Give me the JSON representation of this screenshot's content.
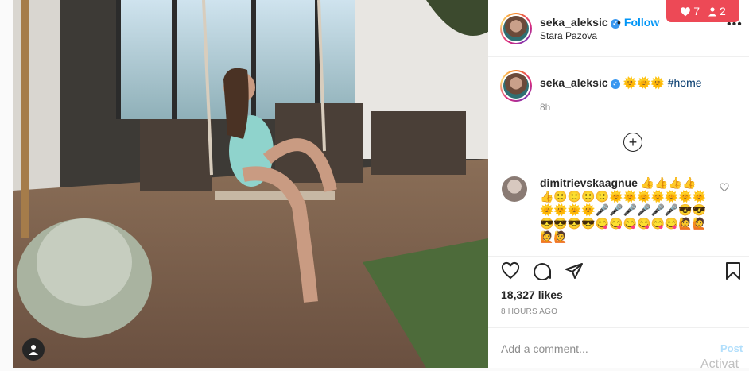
{
  "header": {
    "username": "seka_aleksic",
    "verified_mark": "✓",
    "separator": "•",
    "follow_label": "Follow",
    "location": "Stara Pazova",
    "more_label": "•••"
  },
  "notifications": {
    "likes_count": "7",
    "follows_count": "2",
    "like_icon": "heart-icon",
    "follow_icon": "person-icon",
    "color": "#ed4956"
  },
  "caption": {
    "username": "seka_aleksic",
    "text": "🌞🌞🌞",
    "hashtag": "#home",
    "time": "8h"
  },
  "load_more_label": "+",
  "comment": {
    "username": "dimitrievskaagnue",
    "text": "👍👍👍👍👍🙂🙂🙂🙂🌞🌞🌞🌞🌞🌞🌞🌞🌞🌞🌞🎤🎤🎤🎤🎤🎤😎😎😎😎😎😎😋😋😋😋😋😋🙋🙋🙋🙋"
  },
  "actions": {
    "likes_text": "18,327 likes",
    "time_ago": "8 HOURS AGO"
  },
  "add_comment": {
    "placeholder": "Add a comment...",
    "post_label": "Post"
  },
  "watermark": "Activat",
  "colors": {
    "link": "#0095f6",
    "hashtag": "#00376b",
    "muted": "#8e8e8e"
  }
}
